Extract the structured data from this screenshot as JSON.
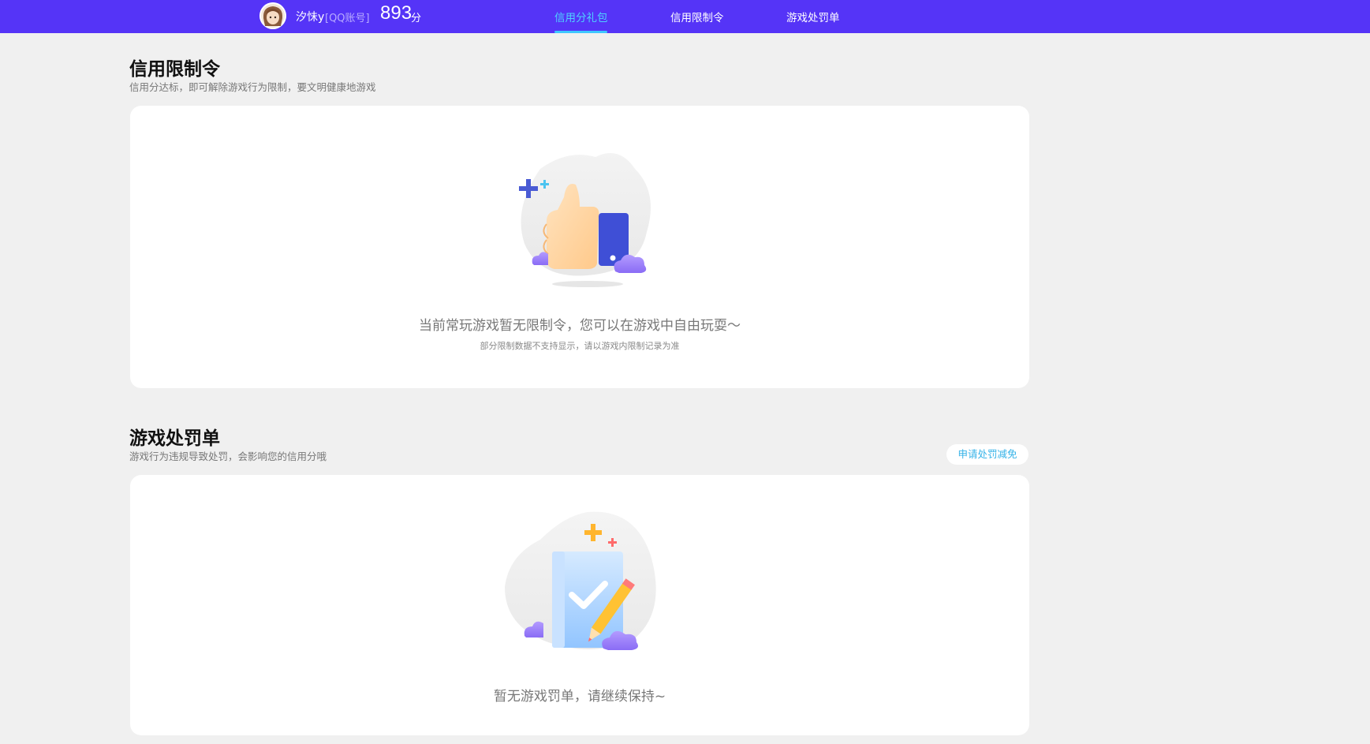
{
  "header": {
    "nickname": "汐怽y",
    "account_type": "[QQ账号]",
    "score": "893",
    "score_unit": "分",
    "tabs": [
      {
        "label": "信用分礼包",
        "active": true
      },
      {
        "label": "信用限制令",
        "active": false
      },
      {
        "label": "游戏处罚单",
        "active": false
      }
    ]
  },
  "restriction": {
    "title": "信用限制令",
    "subtitle": "信用分达标，即可解除游戏行为限制，要文明健康地游戏",
    "empty_text": "当前常玩游戏暂无限制令，您可以在游戏中自由玩耍～",
    "empty_note": "部分限制数据不支持显示，请以游戏内限制记录为准"
  },
  "penalty": {
    "title": "游戏处罚单",
    "subtitle": "游戏行为违规导致处罚，会影响您的信用分哦",
    "appeal_button": "申请处罚减免",
    "empty_text": "暂无游戏罚单，请继续保持~"
  },
  "colors": {
    "header_bg": "#5534f7",
    "active_tab": "#4ed2ff",
    "page_bg": "#f0f0f0",
    "link": "#36b3e8"
  },
  "icons": [
    "avatar",
    "thumbs-up-illustration",
    "checklist-pencil-illustration"
  ]
}
